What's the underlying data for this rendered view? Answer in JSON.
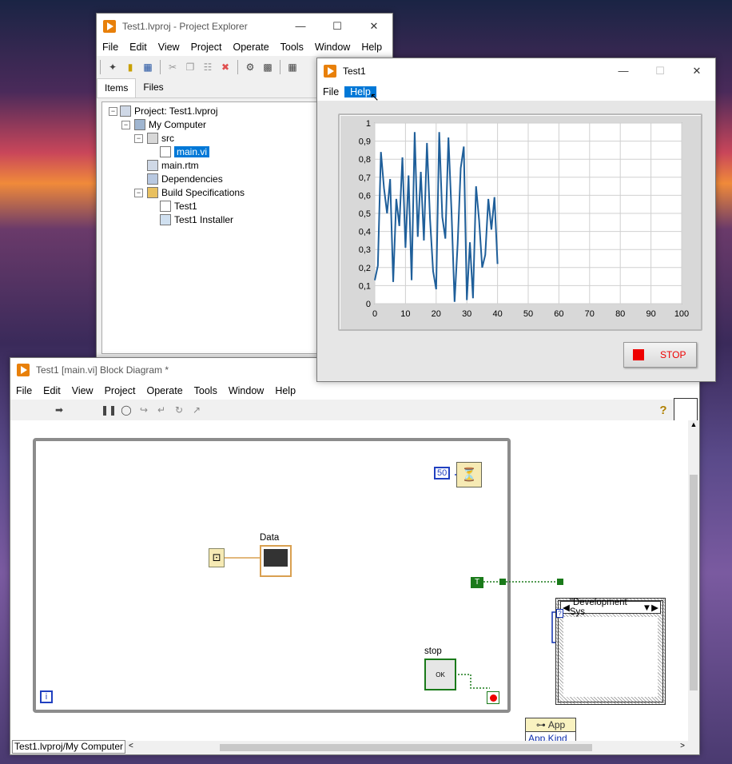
{
  "project_explorer": {
    "title": "Test1.lvproj - Project Explorer",
    "menu": [
      "File",
      "Edit",
      "View",
      "Project",
      "Operate",
      "Tools",
      "Window",
      "Help"
    ],
    "tabs": [
      "Items",
      "Files"
    ],
    "tree": {
      "project": "Project: Test1.lvproj",
      "computer": "My Computer",
      "src": "src",
      "main_vi": "main.vi",
      "main_rtm": "main.rtm",
      "dependencies": "Dependencies",
      "build_specs": "Build Specifications",
      "build_test1": "Test1",
      "build_installer": "Test1 Installer"
    }
  },
  "front_panel": {
    "title": "Test1",
    "menu": [
      "File",
      "Help"
    ],
    "active_menu": "Help",
    "stop_label": "STOP"
  },
  "chart_data": {
    "type": "line",
    "title": "",
    "xlabel": "",
    "ylabel": "",
    "xlim": [
      0,
      100
    ],
    "ylim": [
      0,
      1
    ],
    "x_ticks": [
      "0",
      "10",
      "20",
      "30",
      "40",
      "50",
      "60",
      "70",
      "80",
      "90",
      "100"
    ],
    "y_ticks": [
      "0",
      "0,1",
      "0,2",
      "0,3",
      "0,4",
      "0,5",
      "0,6",
      "0,7",
      "0,8",
      "0,9",
      "1"
    ],
    "series": [
      {
        "color": "#1f5f9a",
        "x": [
          0,
          1,
          2,
          3,
          4,
          5,
          6,
          7,
          8,
          9,
          10,
          11,
          12,
          13,
          14,
          15,
          16,
          17,
          18,
          19,
          20,
          21,
          22,
          23,
          24,
          25,
          26,
          27,
          28,
          29,
          30,
          31,
          32,
          33,
          34,
          35,
          36,
          37,
          38,
          39,
          40
        ],
        "y": [
          0.13,
          0.21,
          0.84,
          0.64,
          0.5,
          0.69,
          0.12,
          0.58,
          0.43,
          0.81,
          0.31,
          0.71,
          0.13,
          0.95,
          0.37,
          0.73,
          0.35,
          0.89,
          0.47,
          0.18,
          0.08,
          0.95,
          0.48,
          0.36,
          0.92,
          0.51,
          0.01,
          0.33,
          0.75,
          0.87,
          0.02,
          0.34,
          0.03,
          0.65,
          0.46,
          0.2,
          0.27,
          0.58,
          0.41,
          0.59,
          0.22
        ]
      }
    ],
    "grid": true
  },
  "block_diagram": {
    "title": "Test1 [main.vi] Block Diagram *",
    "menu": [
      "File",
      "Edit",
      "View",
      "Project",
      "Operate",
      "Tools",
      "Window",
      "Help"
    ],
    "data_label": "Data",
    "stop_label": "stop",
    "wait_const": "50",
    "case_selector": "\"Development Sys",
    "bool_const": "T",
    "prop_class": "App",
    "prop_name": "App.Kind",
    "loop_index": "i",
    "status": "Test1.lvproj/My Computer",
    "help_glyph": "?"
  }
}
